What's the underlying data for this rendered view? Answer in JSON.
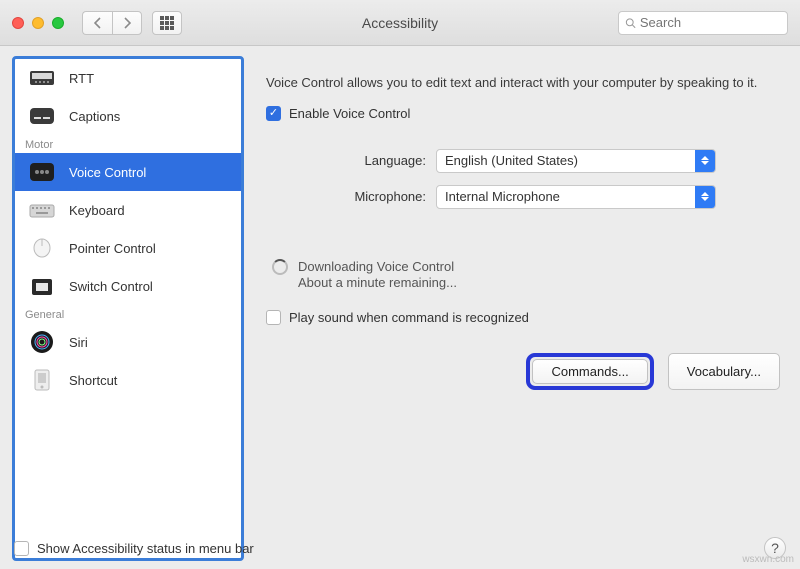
{
  "window": {
    "title": "Accessibility"
  },
  "search": {
    "placeholder": "Search"
  },
  "sidebar": {
    "groups": [
      {
        "label": "",
        "items": [
          {
            "name": "rtt",
            "label": "RTT"
          },
          {
            "name": "captions",
            "label": "Captions"
          }
        ]
      },
      {
        "label": "Motor",
        "items": [
          {
            "name": "voice-control",
            "label": "Voice Control",
            "selected": true
          },
          {
            "name": "keyboard",
            "label": "Keyboard"
          },
          {
            "name": "pointer-control",
            "label": "Pointer Control"
          },
          {
            "name": "switch-control",
            "label": "Switch Control"
          }
        ]
      },
      {
        "label": "General",
        "items": [
          {
            "name": "siri",
            "label": "Siri"
          },
          {
            "name": "shortcut",
            "label": "Shortcut"
          }
        ]
      }
    ]
  },
  "detail": {
    "description": "Voice Control allows you to edit text and interact with your computer by speaking to it.",
    "enable_label": "Enable Voice Control",
    "enable_checked": true,
    "language_label": "Language:",
    "language_value": "English (United States)",
    "microphone_label": "Microphone:",
    "microphone_value": "Internal Microphone",
    "downloading_title": "Downloading Voice Control",
    "downloading_sub": "About a minute remaining...",
    "play_sound_label": "Play sound when command is recognized",
    "play_sound_checked": false,
    "commands_button": "Commands...",
    "vocabulary_button": "Vocabulary..."
  },
  "footer": {
    "status_label": "Show Accessibility status in menu bar",
    "status_checked": false
  },
  "watermark": "wsxwn.com"
}
